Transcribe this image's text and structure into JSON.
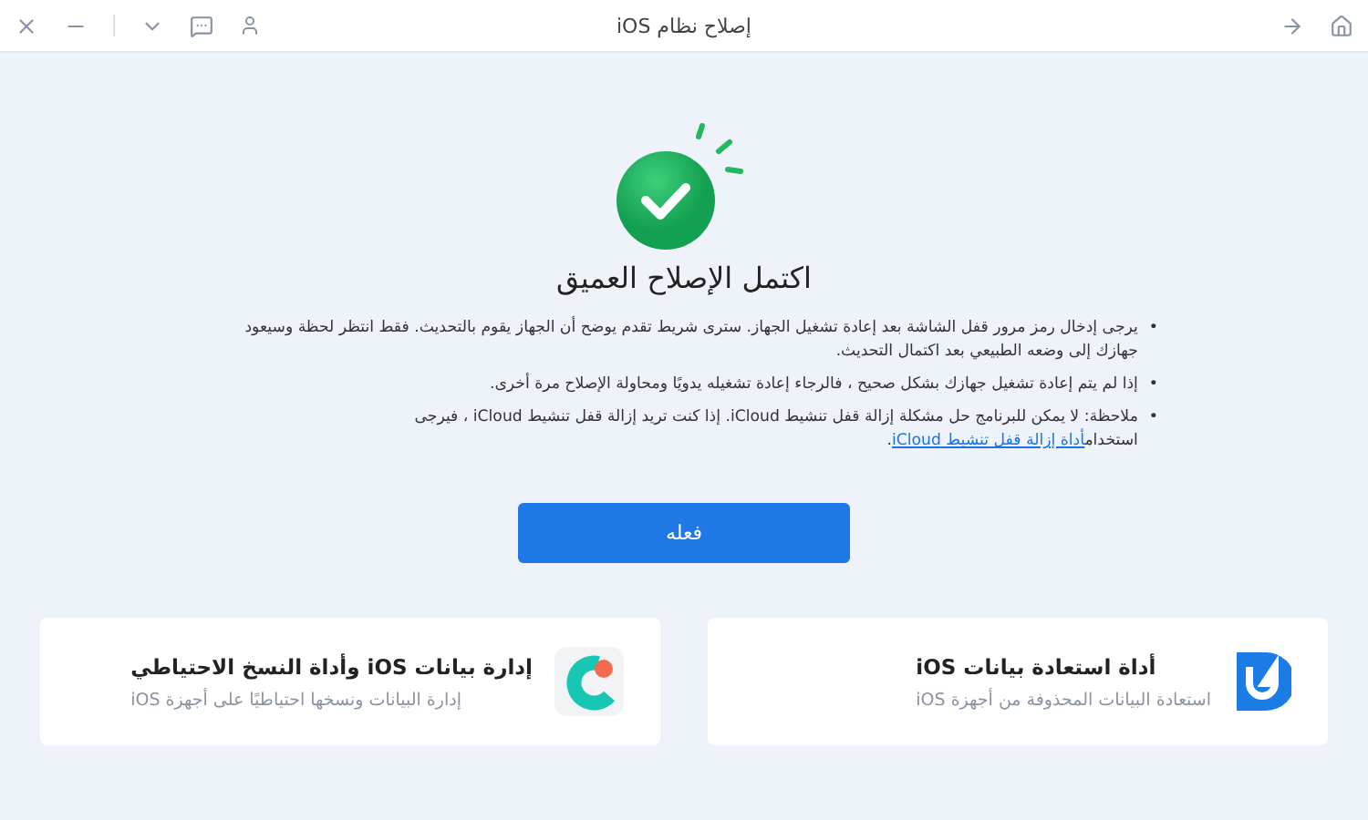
{
  "window": {
    "title": "إصلاح نظام iOS"
  },
  "result": {
    "title": "اكتمل الإصلاح العميق"
  },
  "notes": [
    {
      "bullet": "•",
      "text": "يرجى إدخال رمز مرور قفل الشاشة بعد إعادة تشغيل الجهاز. سترى شريط تقدم يوضح أن الجهاز يقوم بالتحديث. فقط انتظر لحظة وسيعود جهازك إلى وضعه الطبيعي بعد اكتمال التحديث."
    },
    {
      "bullet": "•",
      "text": "إذا لم يتم إعادة تشغيل جهازك بشكل صحيح ، فالرجاء إعادة تشغيله يدويًا ومحاولة الإصلاح مرة أخرى."
    },
    {
      "bullet": "•",
      "text": "ملاحظة: لا يمكن للبرنامج حل مشكلة إزالة قفل تنشيط iCloud. إذا كنت تريد إزالة قفل تنشيط iCloud ، فيرجى استخدام",
      "link": "أداة إزالة قفل تنشيط iCloud",
      "end": "."
    }
  ],
  "action_button": "فعله",
  "products": [
    {
      "kind": "recovery",
      "title": "أداة استعادة بيانات iOS",
      "subtitle": "استعادة البيانات المحذوفة من أجهزة iOS"
    },
    {
      "kind": "manager",
      "title": "إدارة بيانات iOS وأداة النسخ الاحتياطي",
      "subtitle": "إدارة البيانات ونسخها احتياطيًا على أجهزة iOS"
    }
  ]
}
